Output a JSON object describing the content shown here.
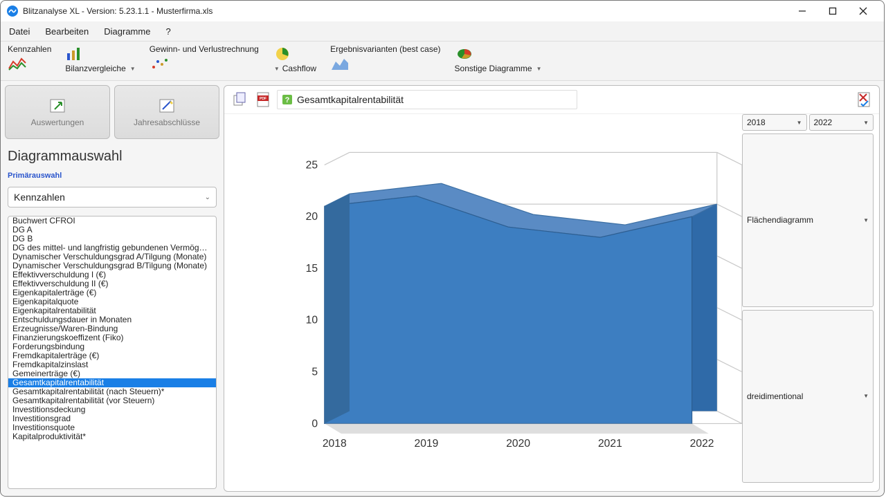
{
  "window": {
    "title": "Blitzanalyse XL - Version: 5.23.1.1 - Musterfirma.xls"
  },
  "menu": {
    "items": [
      "Datei",
      "Bearbeiten",
      "Diagramme",
      "?"
    ]
  },
  "ribbon": {
    "kennzahlen": "Kennzahlen",
    "bilanzvergleiche": "Bilanzvergleiche",
    "gewinn": "Gewinn- und Verlustrechnung",
    "cashflow": "Cashflow",
    "ergebnis": "Ergebnisvarianten (best case)",
    "sonstige": "Sonstige Diagramme"
  },
  "left_buttons": {
    "auswertungen": "Auswertungen",
    "jahres": "Jahresabschlüsse"
  },
  "panel": {
    "title": "Diagrammauswahl",
    "primaer": "Primärauswahl",
    "primary_value": "Kennzahlen"
  },
  "list": {
    "items": [
      "Buchwert CFROI",
      "DG A",
      "DG B",
      "DG des mittel- und langfristig gebundenen Vermögens",
      "Dynamischer Verschuldungsgrad A/Tilgung (Monate)",
      "Dynamischer Verschuldungsgrad B/Tilgung (Monate)",
      "Effektivverschuldung I (€)",
      "Effektivverschuldung II (€)",
      "Eigenkapitalerträge (€)",
      "Eigenkapitalquote",
      "Eigenkapitalrentabilität",
      "Entschuldungsdauer in Monaten",
      "Erzeugnisse/Waren-Bindung",
      "Finanzierungskoeffizent (Fiko)",
      "Forderungsbindung",
      "Fremdkapitalerträge (€)",
      "Fremdkapitalzinslast",
      "Gemeinerträge (€)",
      "Gesamtkapitalrentabilität",
      "Gesamtkapitalrentabilität (nach Steuern)*",
      "Gesamtkapitalrentabilität (vor Steuern)",
      "Investitionsdeckung",
      "Investitionsgrad",
      "Investitionsquote",
      "Kapitalproduktivität*"
    ],
    "selected_index": 18
  },
  "chart_header": {
    "title": "Gesamtkapitalrentabilität"
  },
  "chart_data": {
    "type": "area",
    "categories": [
      "2018",
      "2019",
      "2020",
      "2021",
      "2022"
    ],
    "values": [
      21,
      22,
      19,
      18,
      20
    ],
    "ylim": [
      0,
      25
    ],
    "yticks": [
      0,
      5,
      10,
      15,
      20,
      25
    ]
  },
  "options": {
    "year_from": "2018",
    "year_to": "2022",
    "chart_type": "Flächendiagramm",
    "render_mode": "dreidimentional"
  }
}
